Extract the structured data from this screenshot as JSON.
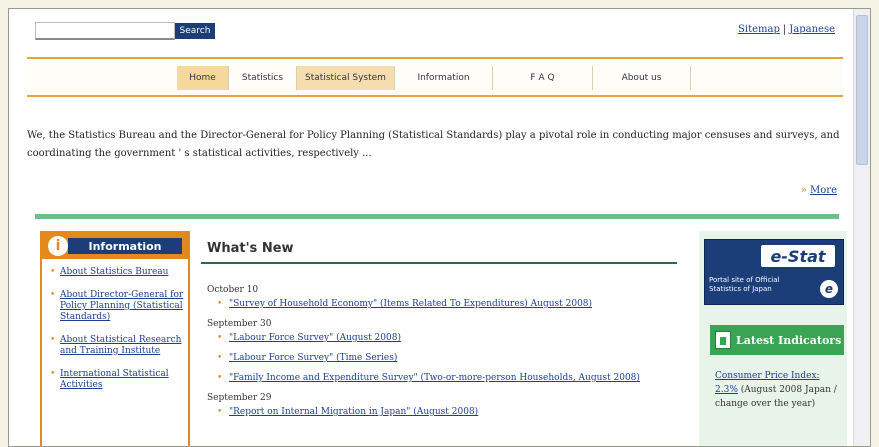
{
  "header": {
    "search_placeholder": "",
    "search_button": "Search",
    "sitemap_link": "Sitemap",
    "separator": "|",
    "japanese_link": "Japanese"
  },
  "nav": {
    "tabs": [
      {
        "label": "Home"
      },
      {
        "label": "Statistics"
      },
      {
        "label": "Statistical System"
      },
      {
        "label": "Information"
      },
      {
        "label": "F A Q"
      },
      {
        "label": "About us"
      }
    ]
  },
  "intro": {
    "text": "We, the Statistics Bureau and the Director-General for Policy Planning (Statistical Standards) play a pivotal role in conducting major censuses and surveys, and coordinating the government ' s statistical activities, respectively ...",
    "more_mark": "»",
    "more_label": "More"
  },
  "information": {
    "icon_letter": "i",
    "title": "Information",
    "items": [
      "About Statistics Bureau",
      "About Director-General for Policy Planning (Statistical Standards)",
      "About Statistical Research and Training Institute",
      "International Statistical Activities"
    ]
  },
  "whats_new": {
    "title": "What's New",
    "groups": [
      {
        "date": "October 10",
        "items": [
          "\"Survey of Household Economy\" (Items Related To Expenditures) August 2008)"
        ]
      },
      {
        "date": "September 30",
        "items": [
          "\"Labour Force Survey\" (August 2008)",
          "\"Labour Force Survey\" (Time Series)",
          "\"Family Income and Expenditure Survey\" (Two-or-more-person Households, August 2008)"
        ]
      },
      {
        "date": "September 29",
        "items": [
          "\"Report on Internal Migration in Japan\" (August 2008)"
        ]
      }
    ]
  },
  "estat": {
    "logo": "e-Stat",
    "subtitle": "Portal site of Official Statistics of Japan",
    "ie_letter": "e"
  },
  "latest": {
    "title": "Latest Indicators",
    "cpi_link": "Consumer Price Index:",
    "cpi_value": "2.3%",
    "cpi_rest": "(August 2008 Japan / change over the year)"
  }
}
